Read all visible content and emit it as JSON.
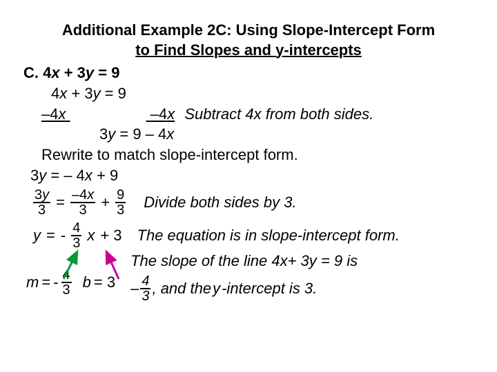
{
  "title_line1": "Additional Example 2C: Using Slope-Intercept Form",
  "title_line2": "to Find Slopes and y-intercepts",
  "lineC_label": "C. 4",
  "lineC_x": "x",
  "lineC_mid": " + 3",
  "lineC_y": "y",
  "lineC_eq": " = 9",
  "line2_a": "4",
  "line2_b": "x",
  "line2_c": " + 3",
  "line2_d": "y",
  "line2_e": " = 9",
  "line3_a": "–4",
  "line3_b": "x",
  "line3_gap": "",
  "line3_c": "–4",
  "line3_d": "x",
  "comment1_a": "Subtract 4",
  "comment1_b": "x",
  "comment1_c": " from both sides.",
  "line4_a": "3",
  "line4_b": "y",
  "line4_c": " = 9 – 4",
  "line4_d": "x",
  "line5": "Rewrite to match slope-intercept form.",
  "line6_a": "3",
  "line6_b": "y",
  "line6_c": " = – 4",
  "line6_d": "x",
  "line6_e": " + 9",
  "frac1_num_a": "3",
  "frac1_num_b": "y",
  "frac1_den": "3",
  "eq_sign": "=",
  "frac2_num_a": "–4",
  "frac2_num_b": "x",
  "frac2_den": "3",
  "plus": "+",
  "frac3_num": "9",
  "frac3_den": "3",
  "comment2": "Divide both sides by 3.",
  "line8_a": "y",
  "line8_b": " =",
  "line8_minus": "-",
  "frac4_num": "4",
  "frac4_den": "3",
  "line8_c": "x",
  "line8_d": " + 3",
  "comment3": "The equation is in slope-intercept form.",
  "line9_m": "m",
  "line9_eq": " =",
  "line9_minus": "-",
  "frac5_num": "4",
  "frac5_den": "3",
  "line9_b": "b",
  "line9_b2": " = 3",
  "comment4_a": "The slope of the line 4",
  "comment4_b": "x",
  "comment4_c": "+ 3",
  "comment4_d": "y",
  "comment4_e": " = 9   is",
  "comment4_f": "– ",
  "comment4_g": ", and the ",
  "comment4_h": "y",
  "comment4_i": "-intercept is 3.",
  "frac6_num": "4",
  "frac6_den": "3"
}
